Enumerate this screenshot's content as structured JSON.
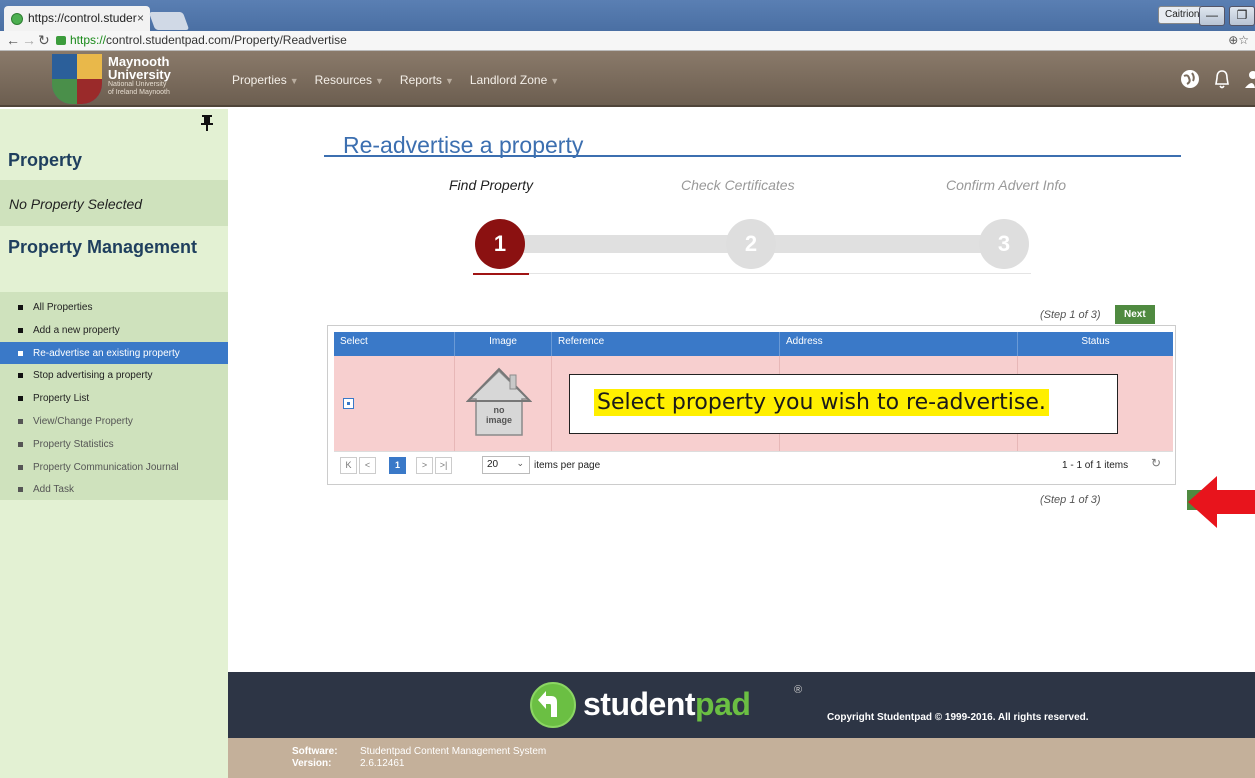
{
  "browser": {
    "tab_title": "https://control.studer",
    "tab_close": "×",
    "url_https": "https://",
    "url_rest": "control.studentpad.com/Property/Readvertise",
    "user_name": "Caitriona",
    "min_glyph": "—",
    "max_glyph": "❐"
  },
  "header": {
    "logo_line1": "Maynooth",
    "logo_line2": "University",
    "logo_line3": "National University",
    "logo_line4": "of Ireland Maynooth",
    "nav": [
      "Properties",
      "Resources",
      "Reports",
      "Landlord Zone"
    ],
    "caret": "▼"
  },
  "sidebar": {
    "property_heading": "Property",
    "no_property": "No Property Selected",
    "management_heading": "Property Management",
    "items": [
      {
        "label": "All Properties"
      },
      {
        "label": "Add a new property"
      },
      {
        "label": "Re-advertise an existing property"
      },
      {
        "label": "Stop advertising a property"
      },
      {
        "label": "Property List"
      },
      {
        "label": "View/Change Property"
      },
      {
        "label": "Property Statistics"
      },
      {
        "label": "Property Communication Journal"
      },
      {
        "label": "Add Task"
      }
    ]
  },
  "main": {
    "title": "Re-advertise a property",
    "steps": [
      {
        "label": "Find Property",
        "number": "1"
      },
      {
        "label": "Check Certificates",
        "number": "2"
      },
      {
        "label": "Confirm Advert Info",
        "number": "3"
      }
    ],
    "step_count": "(Step 1 of 3)",
    "next_label": "Next",
    "grid": {
      "columns": [
        "Select",
        "Image",
        "Reference",
        "Address",
        "Status"
      ],
      "no_image_text1": "no",
      "no_image_text2": "image",
      "pager": {
        "first": "K",
        "prev": "<",
        "current_page": "1",
        "next": ">",
        "last": ">|",
        "page_size": "20",
        "items_per_page": "items per page",
        "info": "1 - 1 of 1 items"
      }
    },
    "callout": "Select property you wish to re-advertise."
  },
  "footer": {
    "brand_a": "student",
    "brand_b": "pad",
    "reg": "®",
    "copyright": "Copyright Studentpad © 1999-2016. All rights reserved.",
    "software_label": "Software:",
    "software_value": "Studentpad Content Management System",
    "version_label": "Version:",
    "version_value": "2.6.12461"
  },
  "colors": {
    "accent_blue": "#3a79c8",
    "step_active": "#8b1111",
    "next_green": "#4f8a40",
    "callout_highlight": "#ffef00",
    "arrow_red": "#e8141c"
  }
}
